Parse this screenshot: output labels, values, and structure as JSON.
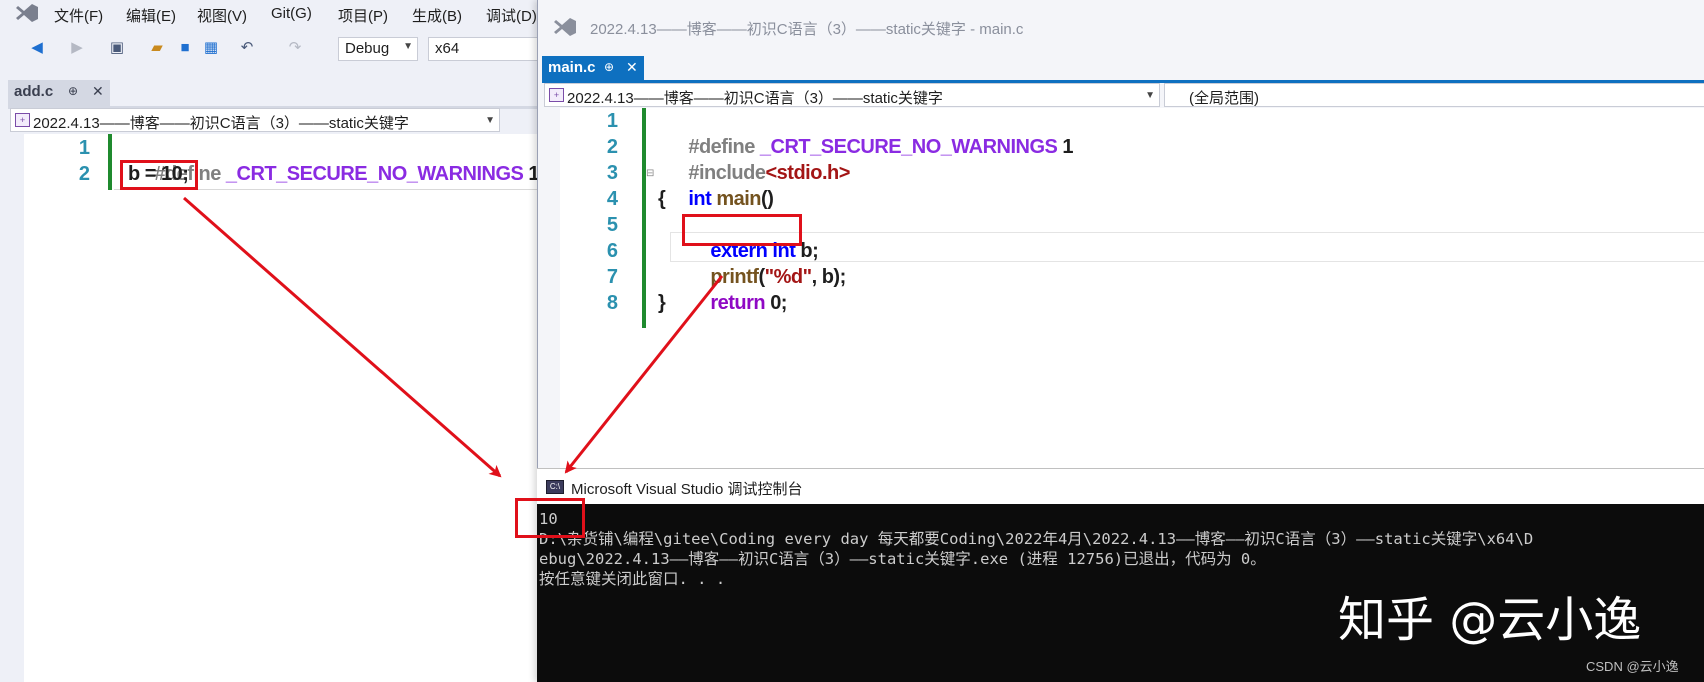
{
  "left_window": {
    "menu": [
      "文件(F)",
      "编辑(E)",
      "视图(V)",
      "Git(G)",
      "项目(P)",
      "生成(B)",
      "调试(D)"
    ],
    "toolbar": {
      "config": "Debug",
      "platform": "x64"
    },
    "tab": {
      "label": "add.c",
      "pin": "⊕",
      "close": "✕"
    },
    "nav_project": "2022.4.13——博客——初识C语言（3）——static关键字",
    "code": [
      {
        "ln": "1",
        "text": "#define _CRT_SECURE_NO_WARNINGS 1"
      },
      {
        "ln": "2",
        "text": "b = 10;"
      }
    ]
  },
  "right_window": {
    "title": "2022.4.13——博客——初识C语言（3）——static关键字 - main.c",
    "tab": {
      "label": "main.c",
      "pin": "⊕",
      "close": "✕"
    },
    "nav_project": "2022.4.13——博客——初识C语言（3）——static关键字",
    "nav_scope": "(全局范围)",
    "code": [
      {
        "ln": "1",
        "text": "#define _CRT_SECURE_NO_WARNINGS 1"
      },
      {
        "ln": "2",
        "text": "#include<stdio.h>"
      },
      {
        "ln": "3",
        "text": "int main()"
      },
      {
        "ln": "4",
        "text": "{"
      },
      {
        "ln": "5",
        "text": "extern int b;"
      },
      {
        "ln": "6",
        "text": "printf(\"%d\", b);"
      },
      {
        "ln": "7",
        "text": "return 0;"
      },
      {
        "ln": "8",
        "text": "}"
      }
    ]
  },
  "console": {
    "title": "Microsoft Visual Studio 调试控制台",
    "icon_label": "C:\\",
    "lines": [
      "10",
      "D:\\杂货铺\\编程\\gitee\\Coding every day 每天都要Coding\\2022年4月\\2022.4.13——博客——初识C语言（3）——static关键字\\x64\\D",
      "ebug\\2022.4.13——博客——初识C语言（3）——static关键字.exe (进程 12756)已退出，代码为 0。",
      "按任意键关闭此窗口. . ."
    ]
  },
  "watermark": "知乎 @云小逸",
  "csdn": "CSDN @云小逸",
  "colors": {
    "tab_active": "#0e70c0",
    "annotation_red": "#e0101a",
    "line_number": "#2b91af",
    "console_bg": "#0c0c0c"
  }
}
